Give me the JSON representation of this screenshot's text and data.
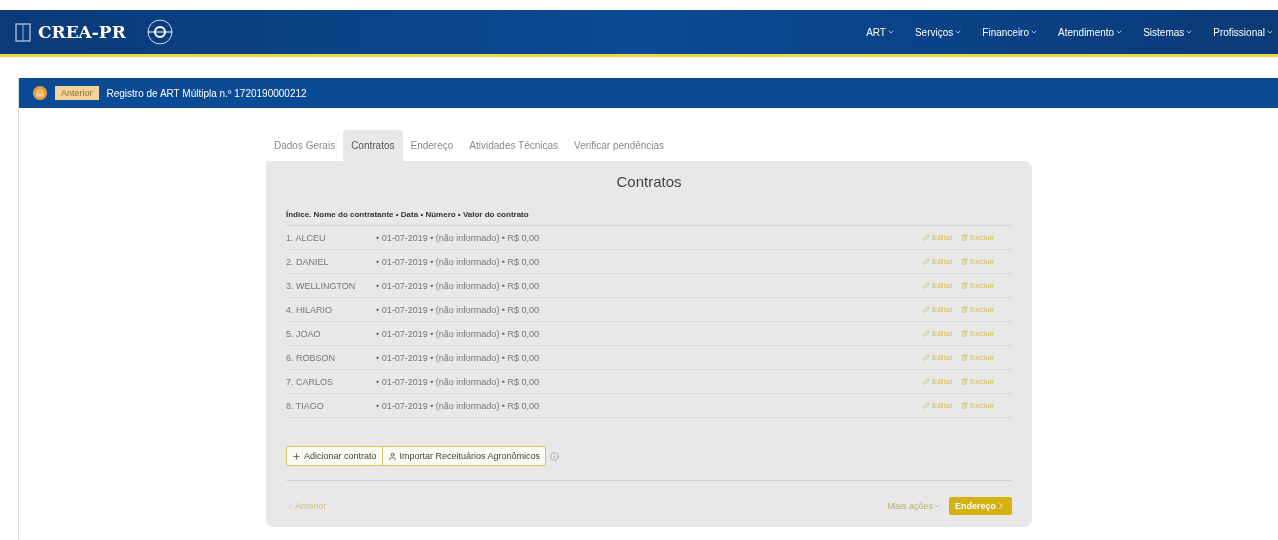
{
  "navbar": {
    "logo": "CREA-PR",
    "menu": [
      {
        "label": "ART"
      },
      {
        "label": "Serviços"
      },
      {
        "label": "Financeiro"
      },
      {
        "label": "Atendimento"
      },
      {
        "label": "Sistemas"
      },
      {
        "label": "Profissional"
      }
    ]
  },
  "breadcrumb": {
    "back": "Anterior",
    "title": "Registro de ART Múltipla n.º 1720190000212"
  },
  "tabs": [
    {
      "label": "Dados Gerais",
      "selected": false
    },
    {
      "label": "Contratos",
      "selected": true
    },
    {
      "label": "Endereço",
      "selected": false
    },
    {
      "label": "Atividades Técnicas",
      "selected": false
    },
    {
      "label": "Verificar pendências",
      "selected": false
    }
  ],
  "panel": {
    "title": "Contratos",
    "header": "Índice. Nome do contratante • Data • Número • Valor do contrato",
    "rows": [
      {
        "name": "1. ALCEU",
        "details": "• 01-07-2019 • (não informado) • R$ 0,00",
        "edit": "Editar",
        "delete": "Excluir"
      },
      {
        "name": "2. DANIEL",
        "details": "• 01-07-2019 • (não informado) • R$ 0,00",
        "edit": "Editar",
        "delete": "Excluir"
      },
      {
        "name": "3. WELLINGTON",
        "details": "• 01-07-2019 • (não informado) • R$ 0,00",
        "edit": "Editar",
        "delete": "Excluir"
      },
      {
        "name": "4. HILARIO",
        "details": "• 01-07-2019 • (não informado) • R$ 0,00",
        "edit": "Editar",
        "delete": "Excluir"
      },
      {
        "name": "5. JOAO",
        "details": "• 01-07-2019 • (não informado) • R$ 0,00",
        "edit": "Editar",
        "delete": "Excluir"
      },
      {
        "name": "6. ROBSON",
        "details": "• 01-07-2019 • (não informado) • R$ 0,00",
        "edit": "Editar",
        "delete": "Excluir"
      },
      {
        "name": "7. CARLOS",
        "details": "• 01-07-2019 • (não informado) • R$ 0,00",
        "edit": "Editar",
        "delete": "Excluir"
      },
      {
        "name": "8. TIAGO",
        "details": "• 01-07-2019 • (não informado) • R$ 0,00",
        "edit": "Editar",
        "delete": "Excluir"
      }
    ],
    "add_button": "Adicionar contrato",
    "import_button": "Importar Receituários Agronômicos",
    "previous": "Anterior",
    "more_actions": "Mais ações",
    "next": "Endereço"
  }
}
